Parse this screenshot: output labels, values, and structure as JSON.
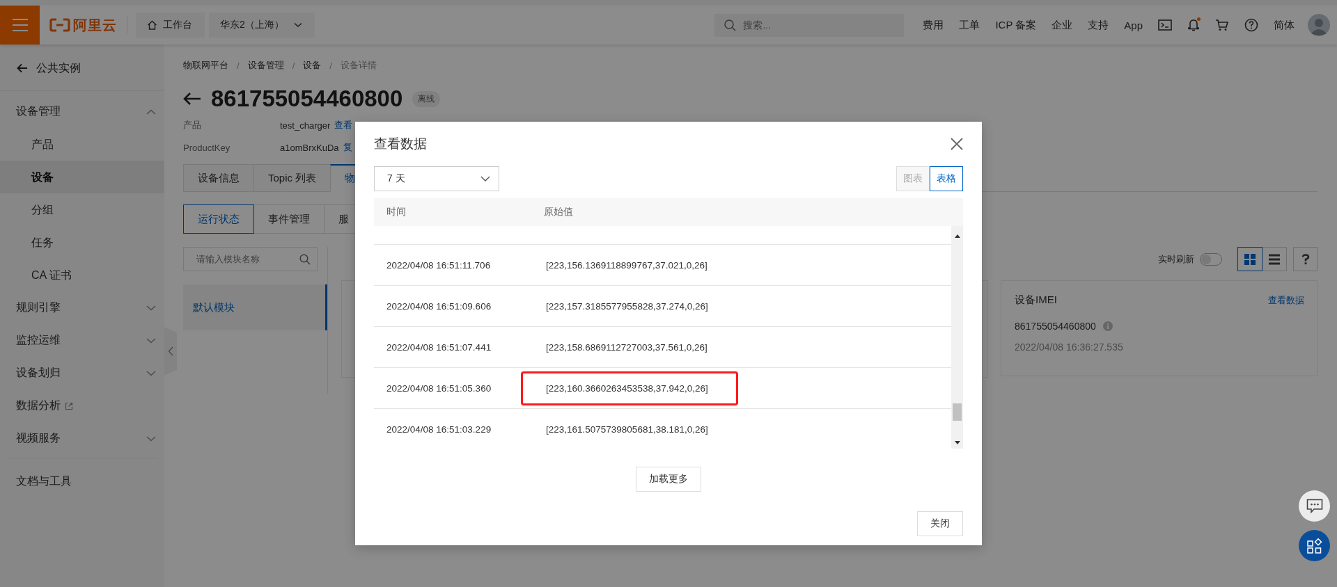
{
  "top_bar": {
    "logo": "阿里云",
    "workbench": "工作台",
    "region": "华东2（上海）",
    "search": {
      "placeholder": "搜索..."
    },
    "links": [
      "费用",
      "工单",
      "ICP 备案",
      "企业",
      "支持",
      "App"
    ],
    "has_notification": true,
    "language": "简体"
  },
  "sidebar": {
    "back": "公共实例",
    "items": [
      {
        "label": "设备管理",
        "kind": "group",
        "expanded": true,
        "children": [
          {
            "label": "产品",
            "selected": false
          },
          {
            "label": "设备",
            "selected": true
          },
          {
            "label": "分组",
            "selected": false
          },
          {
            "label": "任务",
            "selected": false
          },
          {
            "label": "CA 证书",
            "selected": false
          }
        ]
      },
      {
        "label": "规则引擎",
        "kind": "group",
        "expanded": false
      },
      {
        "label": "监控运维",
        "kind": "group",
        "expanded": false
      },
      {
        "label": "设备划归",
        "kind": "group",
        "expanded": false
      },
      {
        "label": "数据分析",
        "kind": "external"
      },
      {
        "label": "视频服务",
        "kind": "group",
        "expanded": false
      }
    ],
    "footer": "文档与工具"
  },
  "breadcrumb": {
    "separator": "/",
    "items": [
      "物联网平台",
      "设备管理",
      "设备",
      "设备详情"
    ]
  },
  "device": {
    "name": "861755054460800",
    "status": "离线"
  },
  "info": [
    {
      "label": "产品",
      "value": "test_charger",
      "link": "查看"
    },
    {
      "label": "ProductKey",
      "value": "a1omBrxKuDa",
      "link": "复"
    }
  ],
  "tabs": [
    {
      "label": "设备信息",
      "selected": false
    },
    {
      "label": "Topic 列表",
      "selected": false
    },
    {
      "label": "物",
      "selected": true
    }
  ],
  "subtabs": [
    {
      "label": "运行状态",
      "selected": true
    },
    {
      "label": "事件管理",
      "selected": false
    },
    {
      "label": "服",
      "selected": false
    }
  ],
  "module_search": {
    "placeholder": "请输入模块名称"
  },
  "modules": [
    {
      "label": "默认模块",
      "selected": true
    }
  ],
  "toolbar": {
    "realtime_label": "实时刷新",
    "realtime_on": false,
    "views": [
      {
        "kind": "grid",
        "selected": true
      },
      {
        "kind": "list",
        "selected": false
      }
    ]
  },
  "card": {
    "title": "设备IMEI",
    "link": "查看数据",
    "value": "861755054460800",
    "time": "2022/04/08 16:36:27.535"
  },
  "modal": {
    "title": "查看数据",
    "range": "7 天",
    "modes": [
      {
        "label": "图表",
        "selected": false
      },
      {
        "label": "表格",
        "selected": true
      }
    ],
    "columns": [
      "时间",
      "原始值"
    ],
    "rows": [
      {
        "time": "2022/04/08 16:51:11.706",
        "value": "[223,156.1369118899767,37.021,0,26]",
        "highlighted": false
      },
      {
        "time": "2022/04/08 16:51:09.606",
        "value": "[223,157.3185577955828,37.274,0,26]",
        "highlighted": false
      },
      {
        "time": "2022/04/08 16:51:07.441",
        "value": "[223,158.6869112727003,37.561,0,26]",
        "highlighted": false
      },
      {
        "time": "2022/04/08 16:51:05.360",
        "value": "[223,160.3660263453538,37.942,0,26]",
        "highlighted": true
      },
      {
        "time": "2022/04/08 16:51:03.229",
        "value": "[223,161.5075739805681,38.181,0,26]",
        "highlighted": false
      }
    ],
    "load_more": "加载更多",
    "close": "关闭"
  }
}
